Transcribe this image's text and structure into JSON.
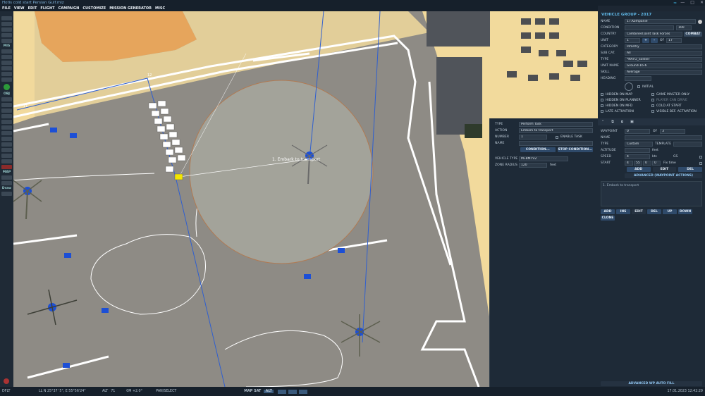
{
  "window": {
    "title": "Hotis cold start Persian Gulf.miz"
  },
  "menu": [
    "FILE",
    "VIEW",
    "EDIT",
    "FLIGHT",
    "CAMPAIGN",
    "CUSTOMIZE",
    "MISSION GENERATOR",
    "MISC"
  ],
  "left_toolbar": {
    "mis_label": "MIS",
    "obj_label": "OBJ",
    "map_label": "MAP",
    "draw_label": "Draw"
  },
  "map": {
    "wp_label": "1. Embark to transport",
    "route_labels": [
      "11",
      "12"
    ]
  },
  "popup": {
    "type_label": "TYPE",
    "type_value": "Perform Task",
    "action_label": "ACTION",
    "action_value": "Embark to transport",
    "number_label": "NUMBER",
    "number_value": "1",
    "enable_task_label": "ENABLE TASK",
    "name_label": "NAME",
    "condition_btn": "CONDITION...",
    "stop_condition_btn": "STOP CONDITION...",
    "vehicle_type_label": "VEHICLE TYPE",
    "vehicle_type_value": "Mi-8MTV2",
    "zone_radius_label": "ZONE RADIUS",
    "zone_radius_value": "120",
    "zone_radius_unit": "feet"
  },
  "panel": {
    "title": "VEHICLE GROUP - 2017",
    "name_label": "NAME",
    "name_value": "17.Kompanie",
    "condition_label": "CONDITION",
    "condition_pct": "100",
    "country_label": "COUNTRY",
    "country_value": "Combined Joint Task Forces",
    "combat_btn": "COMBAT",
    "unit_label": "UNIT",
    "unit_value": "1",
    "unit_of": "OF",
    "unit_total": "17",
    "category_label": "CATEGORY",
    "category_value": "Infantry",
    "subcat_label": "SUB CAT.",
    "subcat_value": "All",
    "type_label": "TYPE",
    "type_value": "*NATO_Soldier",
    "unit_name_label": "UNIT NAME",
    "unit_name_value": "Ground-16-6",
    "skill_label": "SKILL",
    "skill_value": "Average",
    "heading_label": "HEADING",
    "initial_label": "INITIAL",
    "checks_left": [
      "HIDDEN ON MAP",
      "HIDDEN ON PLANNER",
      "HIDDEN ON MFD",
      "LATE ACTIVATION"
    ],
    "checks_right": [
      "GAME MASTER ONLY",
      "PLAYER CAN DRIVE",
      "COLD AT START",
      "VISIBLE BEF. ACTIVATION"
    ],
    "waypoint_label": "WAYPOINT",
    "waypoint_value": "0",
    "waypoint_of": "OF",
    "waypoint_total": "3",
    "wp_name_label": "NAME",
    "wp_type_label": "TYPE",
    "wp_type_value": "Custom",
    "template_label": "TEMPLATE",
    "altitude_label": "ALTITUDE",
    "altitude_unit": "feet",
    "speed_label": "SPEED",
    "speed_value": "4",
    "speed_unit": "kts",
    "gs_label": "GS",
    "start_label": "START",
    "start_h": "4",
    "start_m": "55",
    "start_s": "0",
    "start_d": "0",
    "fix_time_label": "Fix time",
    "add_btn": "ADD",
    "edit_btn": "EDIT",
    "del_btn": "DEL",
    "adv_actions_btn": "ADVANCED (WAYPOINT ACTIONS)",
    "task_list_item": "1. Embark to transport",
    "list_btns": [
      "ADD",
      "INS",
      "EDIT",
      "DEL",
      "UP",
      "DOWN"
    ],
    "clone_btn": "CLONE",
    "adv_autofill_btn": "ADVANCED WP AUTO FILL"
  },
  "status": {
    "profile": "DFLT",
    "coords": "LL  N 25°37' 5\", E 55°56'24\"",
    "alt_label": "ALT",
    "alt_value": "71",
    "mag": "0M  +2.0°",
    "mode": "PAN/SELECT",
    "map_btn": "MAP",
    "sat_btn": "SAT",
    "alt_btn": "ALT",
    "datetime": "17.01.2023 12:42:29"
  }
}
